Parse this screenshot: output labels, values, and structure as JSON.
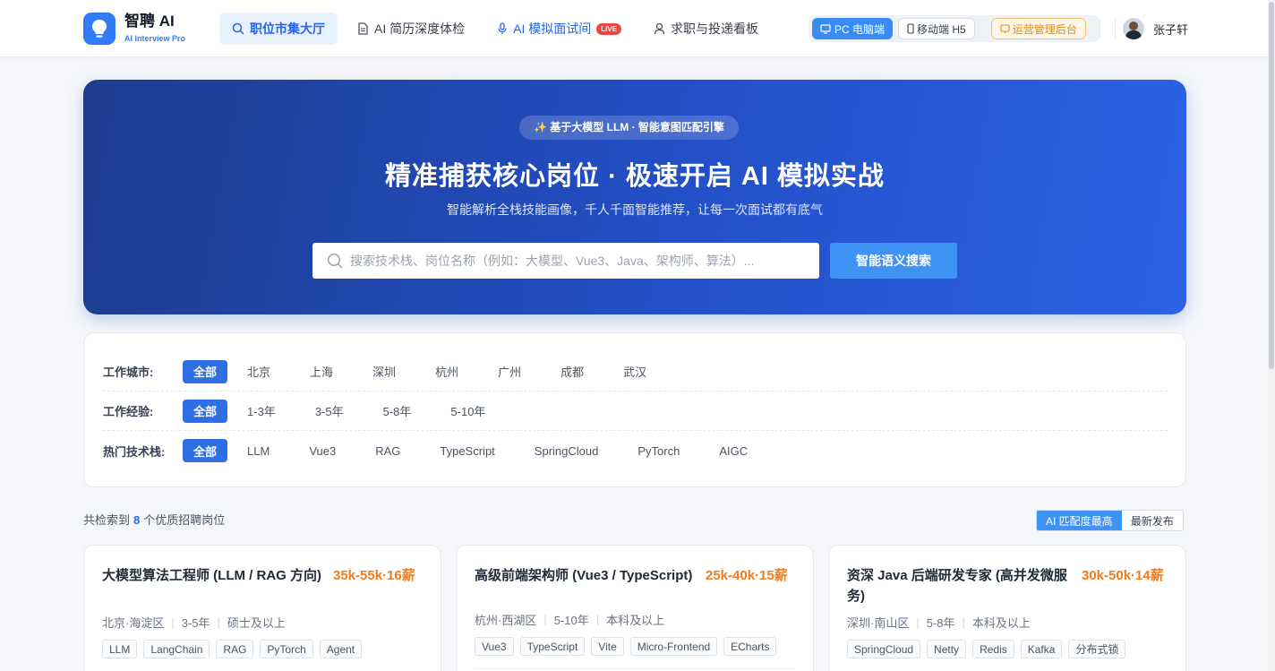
{
  "brand": {
    "name": "智聘 AI",
    "subtitle": "AI Interview Pro"
  },
  "nav": [
    {
      "label": "职位市集大厅",
      "icon": "search-icon",
      "active": true
    },
    {
      "label": "AI 简历深度体检",
      "icon": "document-icon",
      "active": false
    },
    {
      "label": "AI 模拟面试间",
      "icon": "microphone-icon",
      "active": false,
      "badge": "LIVE"
    },
    {
      "label": "求职与投递看板",
      "icon": "user-icon",
      "active": false
    }
  ],
  "switcher": {
    "pc": "PC 电脑端",
    "mobile": "移动端 H5",
    "admin": "运营管理后台"
  },
  "user": {
    "name": "张子轩"
  },
  "hero": {
    "badge": "✨ 基于大模型 LLM · 智能意图匹配引擎",
    "title": "精准捕获核心岗位 · 极速开启 AI 模拟实战",
    "subtitle": "智能解析全栈技能画像，千人千面智能推荐，让每一次面试都有底气",
    "search_placeholder": "搜索技术栈、岗位名称（例如：大模型、Vue3、Java、架构师、算法）...",
    "search_button": "智能语义搜索"
  },
  "filters": {
    "city": {
      "label": "工作城市:",
      "options": [
        "全部",
        "北京",
        "上海",
        "深圳",
        "杭州",
        "广州",
        "成都",
        "武汉"
      ],
      "selected": "全部"
    },
    "experience": {
      "label": "工作经验:",
      "options": [
        "全部",
        "1-3年",
        "3-5年",
        "5-8年",
        "5-10年"
      ],
      "selected": "全部"
    },
    "tech": {
      "label": "热门技术栈:",
      "options": [
        "全部",
        "LLM",
        "Vue3",
        "RAG",
        "TypeScript",
        "SpringCloud",
        "PyTorch",
        "AIGC"
      ],
      "selected": "全部"
    }
  },
  "results": {
    "prefix": "共检索到",
    "count": "8",
    "suffix": "个优质招聘岗位",
    "sort": [
      "AI 匹配度最高",
      "最新发布"
    ],
    "sort_selected": "AI 匹配度最高"
  },
  "jobs": [
    {
      "title": "大模型算法工程师 (LLM / RAG 方向)",
      "salary": "35k-55k·16薪",
      "location": "北京·海淀区",
      "experience": "3-5年",
      "education": "硕士及以上",
      "tags": [
        "LLM",
        "LangChain",
        "RAG",
        "PyTorch",
        "Agent"
      ]
    },
    {
      "title": "高级前端架构师 (Vue3 / TypeScript)",
      "salary": "25k-40k·15薪",
      "location": "杭州·西湖区",
      "experience": "5-10年",
      "education": "本科及以上",
      "tags": [
        "Vue3",
        "TypeScript",
        "Vite",
        "Micro-Frontend",
        "ECharts"
      ]
    },
    {
      "title": "资深 Java 后端研发专家 (高并发微服务)",
      "salary": "30k-50k·14薪",
      "location": "深圳·南山区",
      "experience": "5-8年",
      "education": "本科及以上",
      "tags": [
        "SpringCloud",
        "Netty",
        "Redis",
        "Kafka",
        "分布式锁"
      ]
    }
  ],
  "colors": {
    "primary": "#2563eb",
    "accent": "#3f93f5",
    "salary": "#f27a1a",
    "hero_start": "#1e3c8f",
    "hero_end": "#2c62e6"
  }
}
